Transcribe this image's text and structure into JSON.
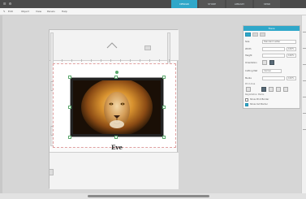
{
  "window": {
    "tabs": [
      {
        "label": "DESIGN",
        "active": true
      },
      {
        "label": "STORE",
        "active": false
      },
      {
        "label": "LIBRARY",
        "active": false
      },
      {
        "label": "SEND",
        "active": false
      }
    ]
  },
  "toolbar": {
    "items": [
      "Edit",
      "Object",
      "View",
      "Panels",
      "Help"
    ]
  },
  "canvas": {
    "caption": "Eve",
    "image_subject": "lion"
  },
  "panel": {
    "title": "Trace",
    "rows": [
      {
        "label": "Size",
        "value": "Standard Letter"
      },
      {
        "label": "Width",
        "value": "",
        "unit": "100%"
      },
      {
        "label": "Height",
        "value": "",
        "unit": "100%"
      },
      {
        "label": "Orientation",
        "value": ""
      },
      {
        "label": "Cutting Mat",
        "value": "Cameo"
      },
      {
        "label": "Media",
        "value": "",
        "unit": "100%"
      }
    ],
    "section_print": "Print Area",
    "section_border": "Registration Marks",
    "checkbox_print": "Show Print Border",
    "checkbox_cut": "Show Cut Border"
  },
  "colors": {
    "accent": "#2fa7c9",
    "titlebar": "#4a4a4a",
    "workspace": "#d6d6d6"
  }
}
